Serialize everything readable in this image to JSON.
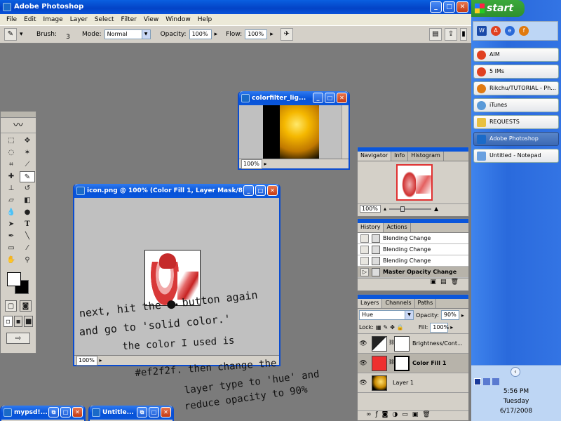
{
  "app": {
    "title": "Adobe Photoshop"
  },
  "menu": [
    "File",
    "Edit",
    "Image",
    "Layer",
    "Select",
    "Filter",
    "View",
    "Window",
    "Help"
  ],
  "options": {
    "brush_label": "Brush:",
    "brush_size": "3",
    "mode_label": "Mode:",
    "mode_value": "Normal",
    "opacity_label": "Opacity:",
    "opacity_value": "100%",
    "flow_label": "Flow:",
    "flow_value": "100%"
  },
  "windows": {
    "colorfilter": {
      "title": "colorfilter_lig...",
      "zoom": "100%"
    },
    "icon": {
      "title": "icon.png @ 100% (Color Fill 1, Layer Mask/8)",
      "zoom": "100%"
    },
    "min1": {
      "title": "mypsd!..."
    },
    "min2": {
      "title": "Untitle..."
    }
  },
  "navigator": {
    "tabs": [
      "Navigator",
      "Info",
      "Histogram"
    ],
    "zoom": "100%"
  },
  "history": {
    "tabs": [
      "History",
      "Actions"
    ],
    "items": [
      "Blending Change",
      "Blending Change",
      "Blending Change",
      "Master Opacity Change"
    ]
  },
  "layers": {
    "tabs": [
      "Layers",
      "Channels",
      "Paths"
    ],
    "blend_mode": "Hue",
    "opacity_label": "Opacity:",
    "opacity_value": "90%",
    "lock_label": "Lock:",
    "fill_label": "Fill:",
    "fill_value": "100%",
    "items": [
      "Brightness/Cont...",
      "Color Fill 1",
      "Layer 1"
    ]
  },
  "handwriting": {
    "line1": "next, hit the",
    "line1b": "button again",
    "line2": "and go to 'solid color.'",
    "line3": "the color I used is",
    "line4": "#ef2f2f.   then change the",
    "line5": "layer type to 'hue' and",
    "line6": "reduce opacity to 90%"
  },
  "taskbar": {
    "start": "start",
    "tasks": [
      "AIM",
      "5 IMs",
      "Rikchu/TUTORIAL - Ph...",
      "iTunes",
      "REQUESTS",
      "Adobe Photoshop",
      "Untitled - Notepad"
    ],
    "active_task": "Adobe Photoshop",
    "time": "5:56 PM",
    "day": "Tuesday",
    "date": "6/17/2008"
  },
  "colors": {
    "fill_color": "#ef2f2f",
    "xp_blue": "#0a56db",
    "start_green": "#2f8f2f"
  }
}
